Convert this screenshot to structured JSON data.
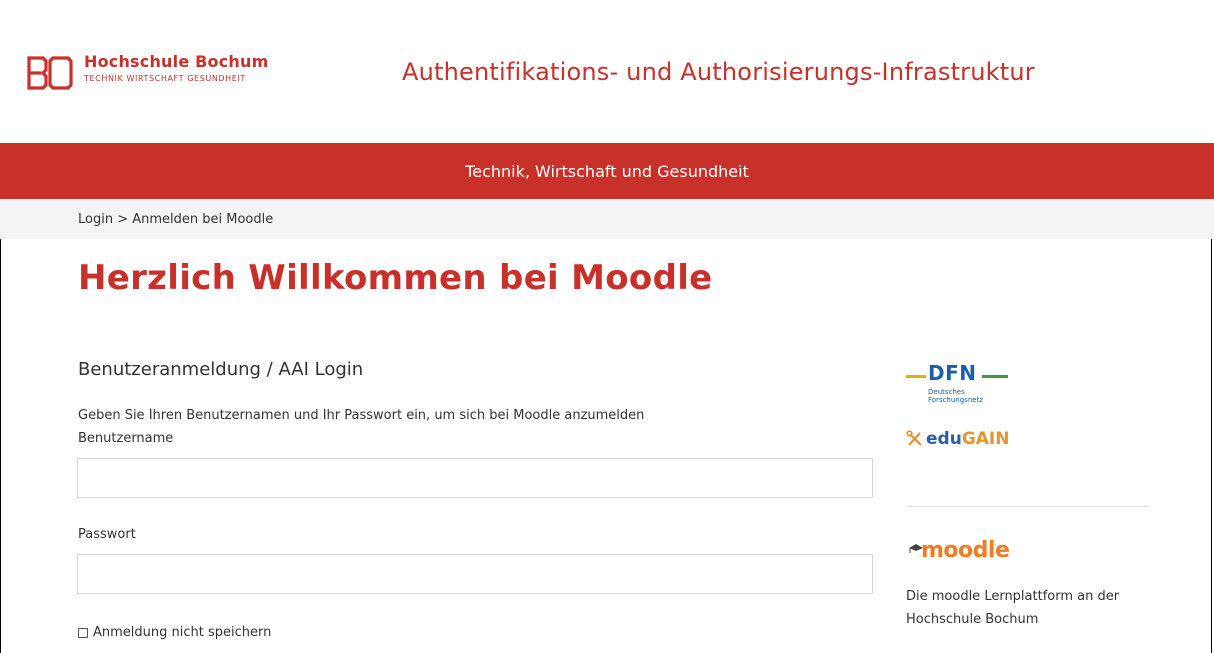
{
  "header": {
    "logo_title": "Hochschule Bochum",
    "logo_subtitle": "TECHNIK WIRTSCHAFT GESUNDHEIT",
    "site_title": "Authentifikations- und Authorisierungs-Infrastruktur"
  },
  "banner": {
    "text": "Technik, Wirtschaft und Gesundheit"
  },
  "breadcrumb": {
    "text": "Login > Anmelden bei Moodle"
  },
  "page_title": "Herzlich Willkommen bei Moodle",
  "login": {
    "heading": "Benutzeranmeldung / AAI Login",
    "intro": "Geben Sie Ihren Benutzernamen und Ihr Passwort ein, um sich bei Moodle anzumelden",
    "username_label": "Benutzername",
    "username_value": "",
    "password_label": "Passwort",
    "password_value": "",
    "remember_label": "Anmeldung nicht speichern",
    "remember_checked": false
  },
  "sidebar": {
    "dfn_word": "DFN",
    "dfn_sub_1": "Deutsches",
    "dfn_sub_2": "Forschungsnetz",
    "edugain_edu": "edu",
    "edugain_gain": "GAIN",
    "moodle_logo": "moodle",
    "moodle_description": "Die moodle Lernplattform an der Hochschule Bochum"
  },
  "colors": {
    "brand_red": "#c8302a",
    "crumb_bg": "#f4f4f4",
    "dfn_blue": "#1b5fa8",
    "moodle_orange": "#f07d22"
  }
}
